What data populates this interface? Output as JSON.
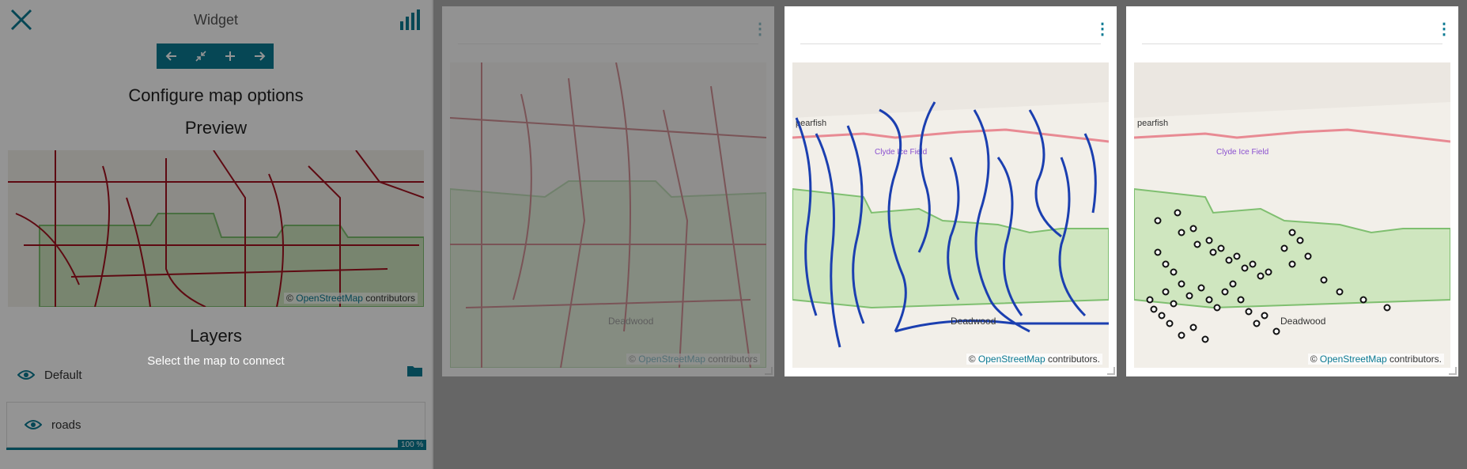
{
  "panel": {
    "title": "Widget",
    "configure_title": "Configure map options",
    "preview_title": "Preview",
    "layers_title": "Layers",
    "select_message": "Select the map to connect",
    "default_layer": "Default",
    "roads_layer": "roads",
    "opacity": "100 %",
    "attribution_prefix": "©",
    "attribution_link": "OpenStreetMap",
    "attribution_suffix": "contributors"
  },
  "toolbar": {
    "back_icon": "arrow-left-icon",
    "collapse_icon": "collapse-icon",
    "add_icon": "plus-icon",
    "forward_icon": "arrow-right-icon"
  },
  "cards": [
    {
      "attribution_prefix": "©",
      "attribution_link": "OpenStreetMap",
      "attribution_suffix": "contributors",
      "place_label": "Deadwood"
    },
    {
      "attribution_prefix": "©",
      "attribution_link": "OpenStreetMap",
      "attribution_suffix": "contributors.",
      "place_label": "Deadwood",
      "town_label": "pearfish",
      "airport_label": "Clyde Ice Field"
    },
    {
      "attribution_prefix": "©",
      "attribution_link": "OpenStreetMap",
      "attribution_suffix": "contributors.",
      "place_label": "Deadwood",
      "town_label": "pearfish",
      "airport_label": "Clyde Ice Field"
    }
  ],
  "colors": {
    "accent": "#0b7a93",
    "roads": "#a3121f",
    "rivers": "#1b3fb0",
    "forest": "#cfe6bf"
  }
}
